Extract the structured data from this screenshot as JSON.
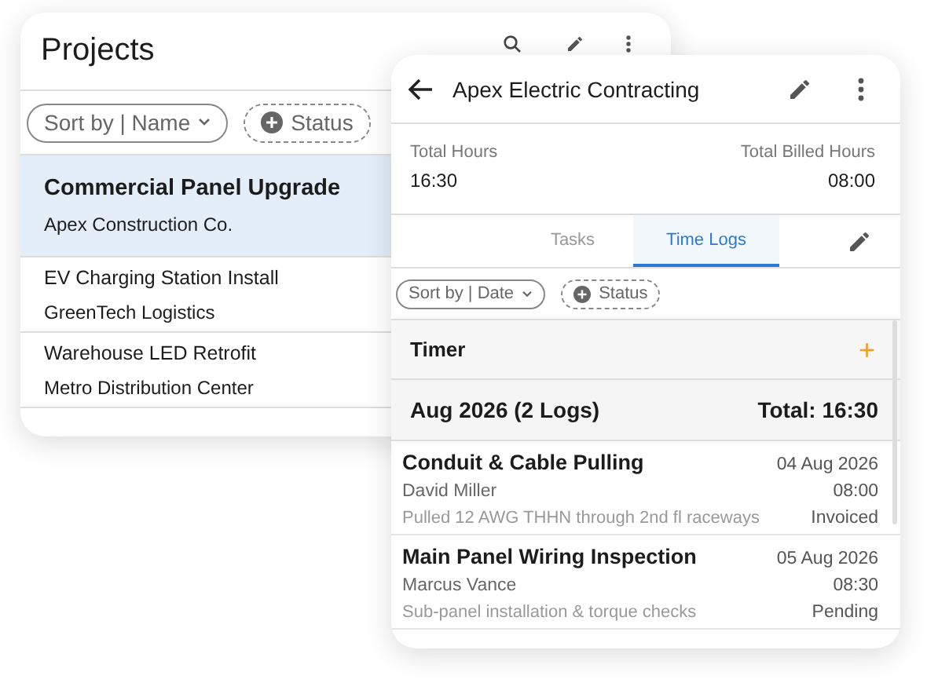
{
  "projects": {
    "title": "Projects",
    "filters": [
      {
        "kind": "sort",
        "label": "Sort by | Name"
      },
      {
        "kind": "add",
        "label": "Status"
      }
    ],
    "items": [
      {
        "name": "Commercial Panel Upgrade",
        "client": "Apex Construction Co.",
        "selected": true
      },
      {
        "name": "EV Charging Station Install",
        "client": "GreenTech Logistics",
        "selected": false
      },
      {
        "name": "Warehouse LED Retrofit",
        "client": "Metro Distribution Center",
        "selected": false
      }
    ]
  },
  "detail": {
    "title": "Apex Electric Contracting",
    "totals": [
      {
        "label": "Total Hours",
        "value": "16:30"
      },
      {
        "label": "Total Billed Hours",
        "value": "08:00"
      }
    ],
    "tabs": [
      {
        "label": "Tasks",
        "selected": false
      },
      {
        "label": "Time Logs",
        "selected": true
      }
    ],
    "filters": [
      {
        "kind": "sort",
        "label": "Sort by | Date"
      },
      {
        "kind": "add",
        "label": "Status"
      }
    ],
    "timer": {
      "label": "Timer",
      "action": "+"
    },
    "group": {
      "label": "Aug 2026 (2 Logs)",
      "total": "Total: 16:30"
    },
    "logs": [
      {
        "task": "Conduit & Cable Pulling",
        "date": "04 Aug 2026",
        "person": "David Miller",
        "hours": "08:00",
        "note": "Pulled 12 AWG THHN through 2nd fl raceways",
        "status": "Invoiced"
      },
      {
        "task": "Main Panel Wiring Inspection",
        "date": "05 Aug 2026",
        "person": "Marcus Vance",
        "hours": "08:30",
        "note": "Sub-panel installation & torque checks",
        "status": "Pending"
      }
    ]
  }
}
